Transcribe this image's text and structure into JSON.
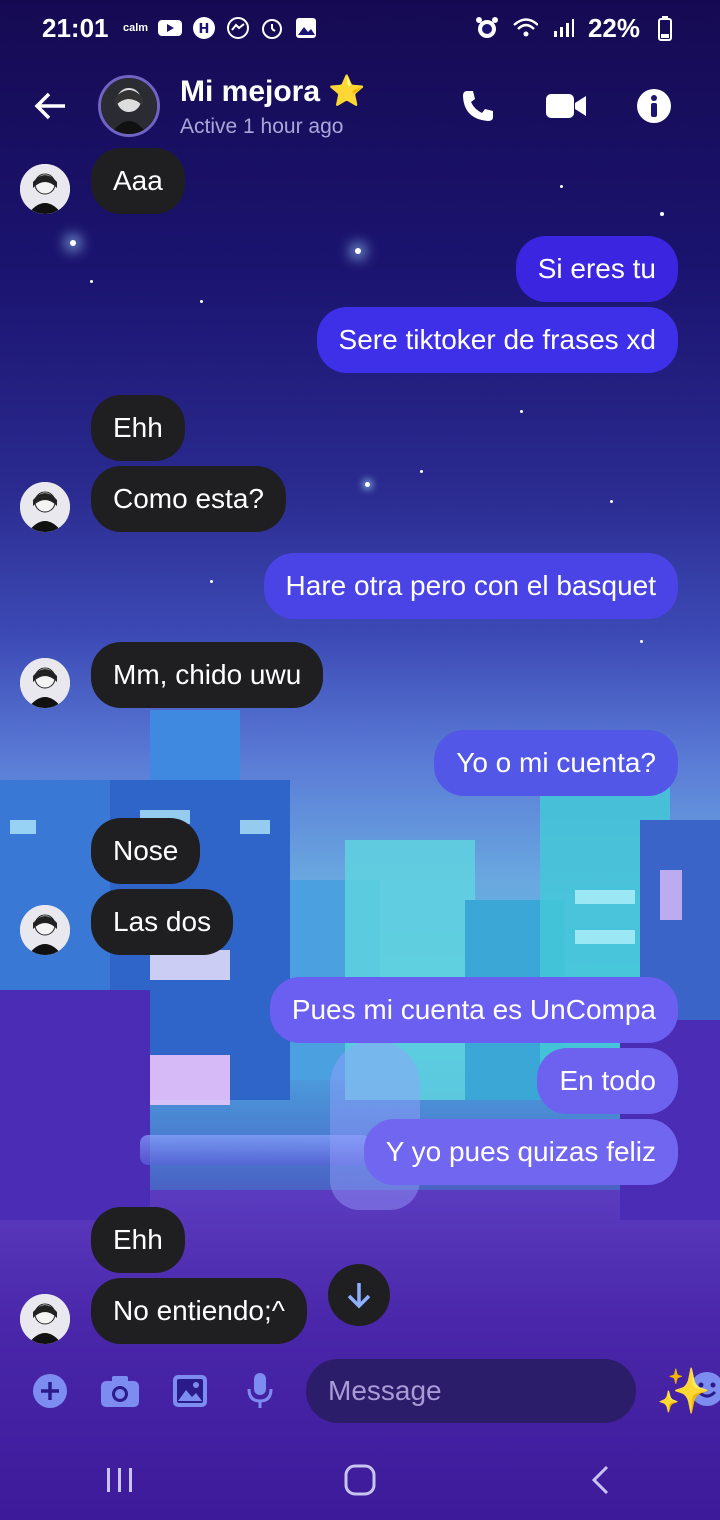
{
  "status_bar": {
    "time": "21:01",
    "battery": "22%",
    "left_icons": [
      "calm-icon",
      "youtube-icon",
      "hack-icon",
      "messenger-icon",
      "alarm-icon",
      "gallery-icon"
    ],
    "right_icons": [
      "alarm-icon",
      "wifi-icon",
      "signal-icon",
      "battery-icon"
    ]
  },
  "header": {
    "contact_name": "Mi mejora",
    "name_emoji": "⭐",
    "status": "Active 1 hour ago"
  },
  "messages": [
    {
      "direction": "in",
      "text": "Aaa"
    },
    {
      "direction": "out",
      "text": "Si eres tu"
    },
    {
      "direction": "out",
      "text": "Sere tiktoker de frases xd"
    },
    {
      "direction": "in",
      "text": "Ehh"
    },
    {
      "direction": "in",
      "text": "Como esta?"
    },
    {
      "direction": "out",
      "text": "Hare otra pero con el basquet"
    },
    {
      "direction": "in",
      "text": "Mm, chido uwu"
    },
    {
      "direction": "out",
      "text": "Yo o mi cuenta?"
    },
    {
      "direction": "in",
      "text": "Nose"
    },
    {
      "direction": "in",
      "text": "Las dos"
    },
    {
      "direction": "out",
      "text": "Pues mi cuenta es UnCompa"
    },
    {
      "direction": "out",
      "text": "En todo"
    },
    {
      "direction": "out",
      "text": "Y yo pues quizas feliz"
    },
    {
      "direction": "in",
      "text": "Ehh"
    },
    {
      "direction": "in",
      "text": "No entiendo;^"
    }
  ],
  "composer": {
    "placeholder": "Message",
    "action_emoji": "✨"
  },
  "colors": {
    "accent": "#4f46e5",
    "incoming_bubble": "#1f1f22",
    "composer_icon": "#7c8cf0"
  }
}
